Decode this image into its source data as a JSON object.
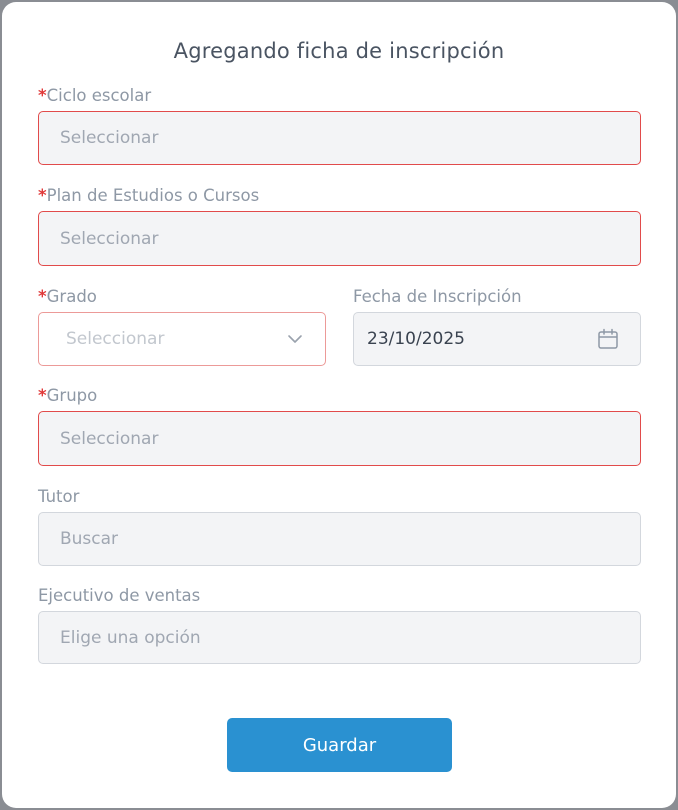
{
  "modal": {
    "title": "Agregando ficha de inscripción"
  },
  "fields": {
    "ciclo": {
      "required_mark": "*",
      "label": "Ciclo escolar",
      "placeholder": "Seleccionar"
    },
    "plan": {
      "required_mark": "*",
      "label": "Plan de Estudios o Cursos",
      "placeholder": "Seleccionar"
    },
    "grado": {
      "required_mark": "*",
      "label": "Grado",
      "placeholder": "Seleccionar",
      "icon": "chevron-down-icon"
    },
    "fecha": {
      "label": "Fecha de Inscripción",
      "value": "23/10/2025",
      "icon": "calendar-icon"
    },
    "grupo": {
      "required_mark": "*",
      "label": "Grupo",
      "placeholder": "Seleccionar"
    },
    "tutor": {
      "label": "Tutor",
      "placeholder": "Buscar"
    },
    "ejecutivo": {
      "label": "Ejecutivo de ventas",
      "placeholder": "Elige una opción"
    }
  },
  "actions": {
    "save_label": "Guardar"
  },
  "colors": {
    "primary": "#2a91d1",
    "required": "#e03a3a",
    "error_border": "#e14b4b",
    "label": "#8e98a5",
    "field_bg": "#f3f4f6"
  }
}
